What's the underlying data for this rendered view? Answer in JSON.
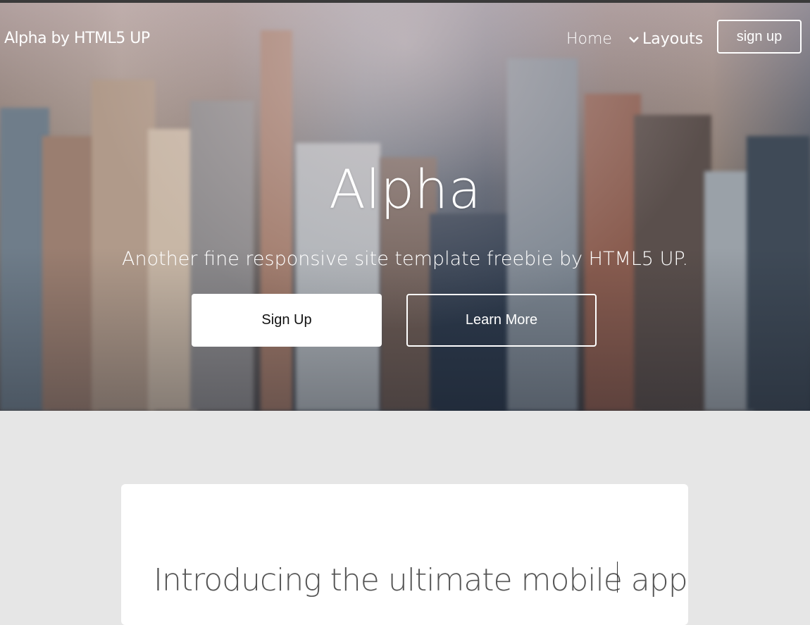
{
  "header": {
    "brand": "Alpha by HTML5 UP",
    "nav": {
      "home": "Home",
      "layouts": "Layouts",
      "signup": "sign up"
    }
  },
  "hero": {
    "title": "Alpha",
    "subtitle": "Another fine responsive site template freebie by HTML5 UP.",
    "primary_button": "Sign Up",
    "secondary_button": "Learn More"
  },
  "main": {
    "card_title": "Introducing the ultimate mobile app"
  },
  "colors": {
    "page_background": "#e6e6e6",
    "card_background": "#ffffff",
    "hero_text": "#ffffff"
  },
  "icons": {
    "layouts_dropdown": "chevron-down-icon"
  }
}
